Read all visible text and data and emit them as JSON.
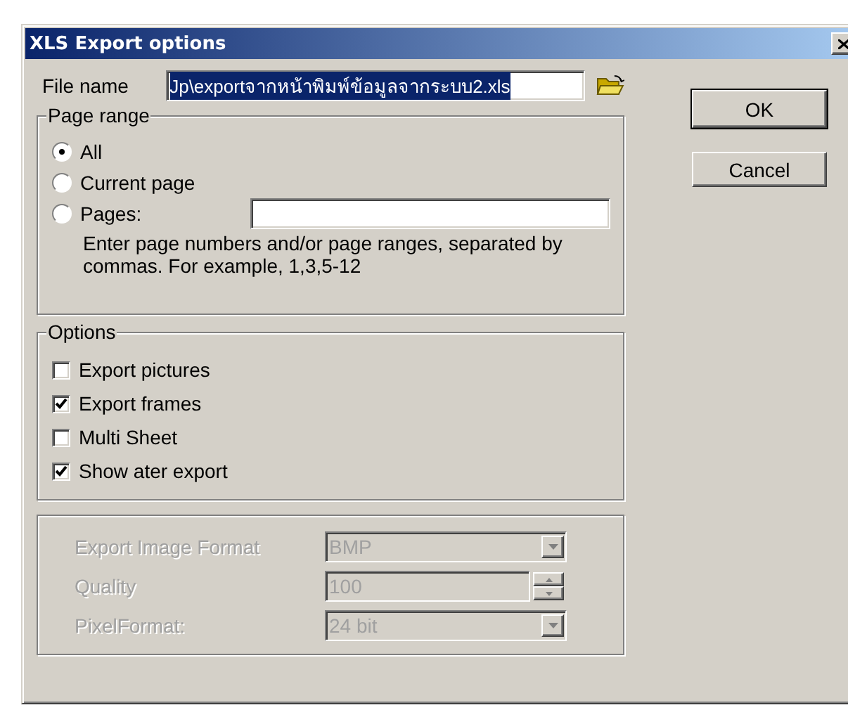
{
  "window": {
    "title": "XLS Export options"
  },
  "file_name": {
    "label": "File name",
    "value": "Jp\\exportจากหน้าพิมพ์ข้อมูลจากระบบ2.xls",
    "text_selected": true
  },
  "page_range": {
    "title": "Page range",
    "options": [
      {
        "label": "All",
        "selected": true
      },
      {
        "label": "Current page",
        "selected": false
      },
      {
        "label": "Pages:",
        "selected": false
      }
    ],
    "hint": "Enter page numbers and/or page ranges, separated by commas. For example, 1,3,5-12"
  },
  "options": {
    "title": "Options",
    "items": [
      {
        "label": "Export pictures",
        "checked": false
      },
      {
        "label": "Export frames",
        "checked": true
      },
      {
        "label": "Multi Sheet",
        "checked": false
      },
      {
        "label": "Show ater export",
        "checked": true
      }
    ]
  },
  "image_settings": {
    "disabled": true,
    "fields": [
      {
        "kind": "dropdown",
        "label": "Export Image Format",
        "value": "BMP"
      },
      {
        "kind": "spinner",
        "label": "Quality",
        "value": "100"
      },
      {
        "kind": "dropdown",
        "label": "PixelFormat:",
        "value": "24 bit"
      }
    ]
  },
  "buttons": [
    {
      "label": "OK",
      "default": true
    },
    {
      "label": "Cancel",
      "default": false
    }
  ]
}
